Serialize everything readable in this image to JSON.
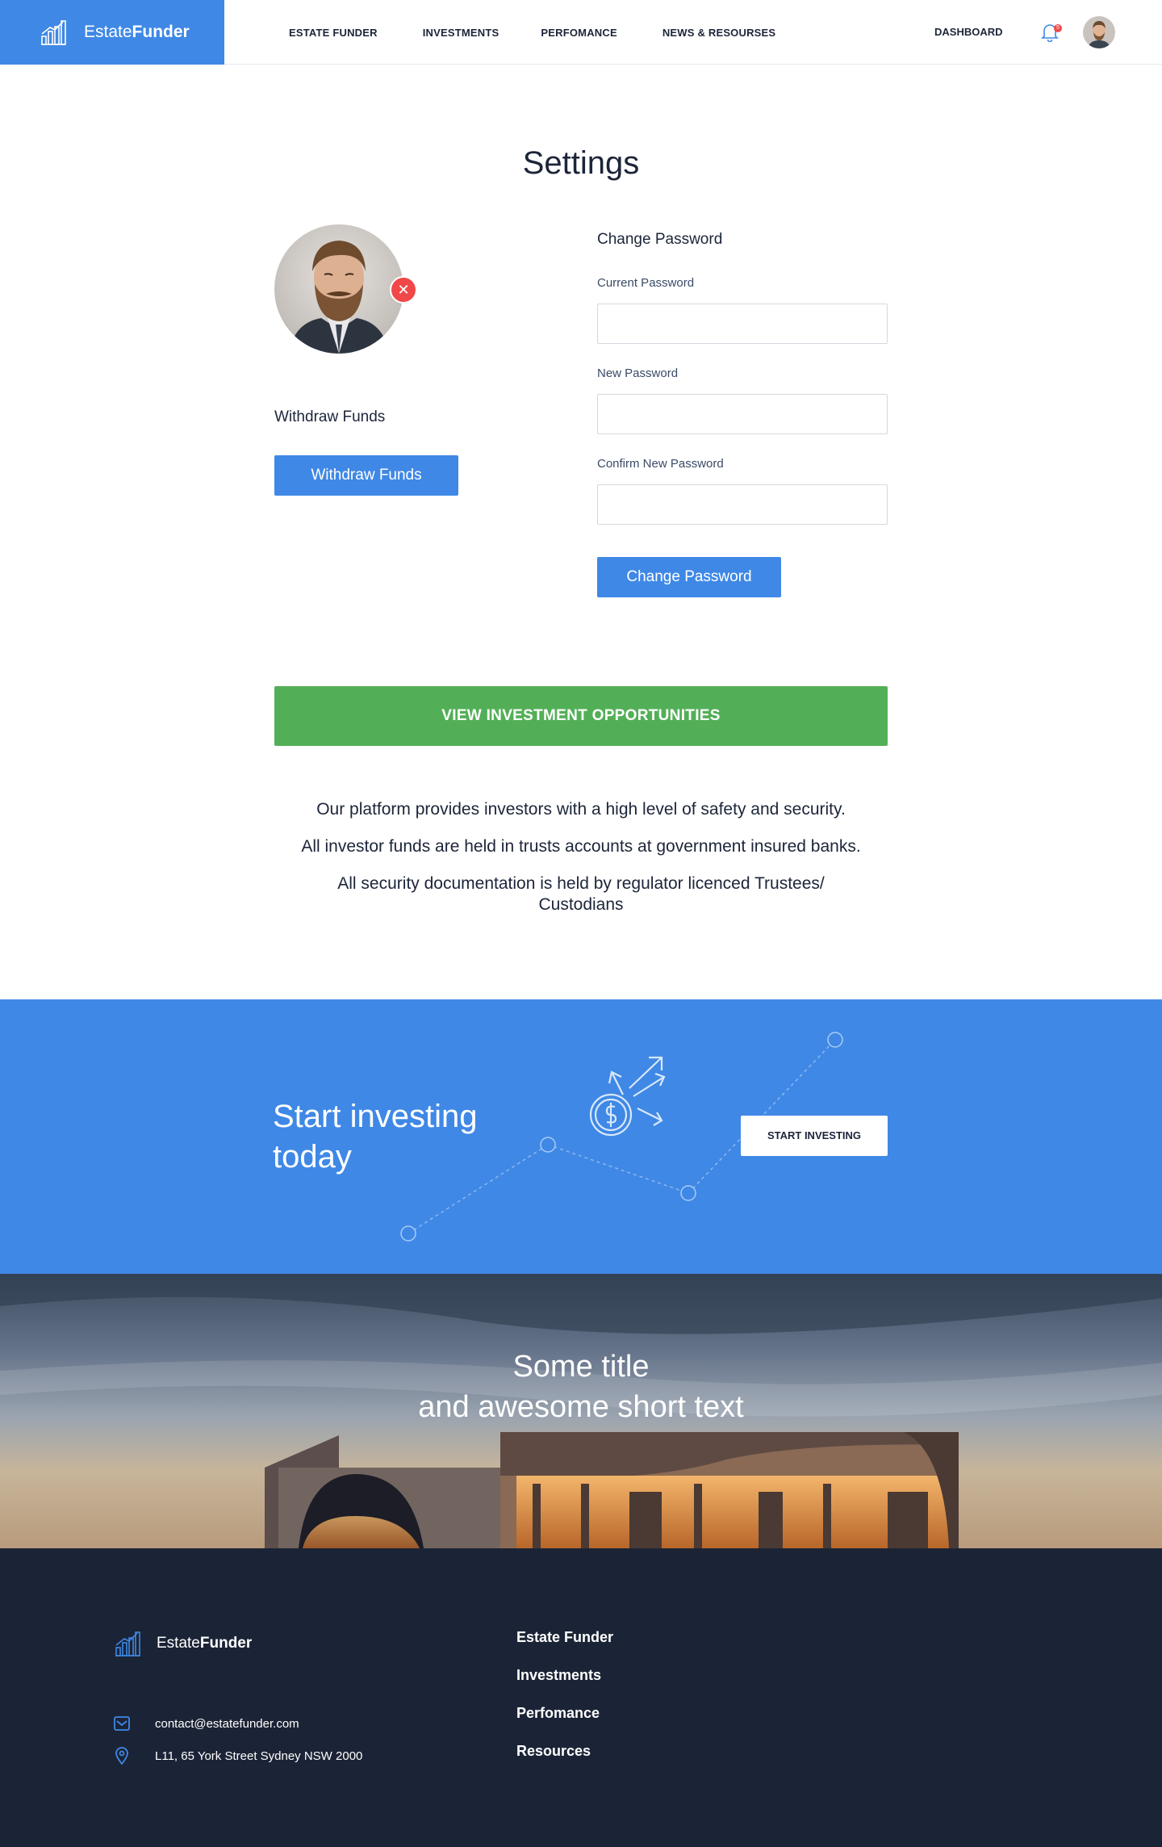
{
  "brand": {
    "name_plain": "Estate",
    "name_bold": "Funder"
  },
  "nav": {
    "items": [
      "ESTATE FUNDER",
      "INVESTMENTS",
      "PERFOMANCE",
      "NEWS & RESOURSES"
    ],
    "dashboard": "DASHBOARD",
    "notification_count": "5"
  },
  "settings": {
    "title": "Settings",
    "withdraw_heading": "Withdraw Funds",
    "withdraw_button": "Withdraw Funds",
    "change_password_heading": "Change Password",
    "current_password_label": "Current Password",
    "current_password_value": "",
    "new_password_label": "New Password",
    "new_password_value": "",
    "confirm_password_label": "Confirm New Password",
    "confirm_password_value": "",
    "change_password_button": "Change Password"
  },
  "cta": {
    "view_opportunities": "VIEW INVESTMENT OPPORTUNITIES"
  },
  "info": {
    "line1": "Our platform provides investors with a high level of safety and security.",
    "line2": "All investor funds are held in trusts accounts at government insured banks.",
    "line3": "All security documentation is held by regulator licenced Trustees/ Custodians"
  },
  "band": {
    "title": "Start investing today",
    "button": "START INVESTING"
  },
  "hero": {
    "line1": "Some title",
    "line2": "and awesome short text"
  },
  "footer": {
    "email": "contact@estatefunder.com",
    "address": "L11, 65 York Street Sydney NSW 2000",
    "links": [
      "Estate Funder",
      "Investments",
      "Perfomance",
      "Resources"
    ]
  },
  "colors": {
    "primary": "#3f88e6",
    "success": "#53af57",
    "footer": "#1b2436",
    "danger": "#f04848"
  },
  "icons": [
    "logo-chart-icon",
    "bell-icon",
    "close-icon",
    "money-arrows-icon",
    "mail-icon",
    "location-pin-icon"
  ]
}
